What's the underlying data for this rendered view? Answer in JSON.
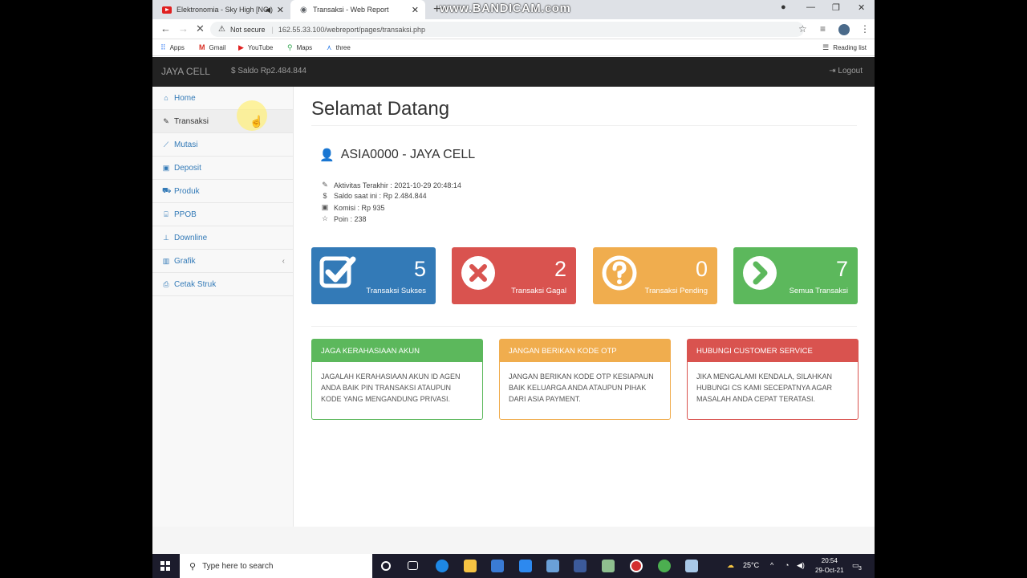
{
  "browser": {
    "tabs": [
      {
        "title": "Elektronomia - Sky High [NC",
        "icon": "youtube-icon"
      },
      {
        "title": "Transaksi - Web Report",
        "icon": "page-icon"
      }
    ],
    "watermark": "www.BANDICAM.com",
    "security": "Not secure",
    "url": "162.55.33.100/webreport/pages/transaksi.php",
    "bookmarks": [
      "Apps",
      "Gmail",
      "YouTube",
      "Maps",
      "three"
    ],
    "reading_list": "Reading list"
  },
  "app": {
    "brand": "JAYA CELL",
    "saldo": "Saldo Rp2.484.844",
    "logout": "Logout"
  },
  "sidebar": {
    "items": [
      {
        "label": "Home",
        "icon": "home-icon"
      },
      {
        "label": "Transaksi",
        "icon": "edit-icon"
      },
      {
        "label": "Mutasi",
        "icon": "line-chart-icon"
      },
      {
        "label": "Deposit",
        "icon": "money-icon"
      },
      {
        "label": "Produk",
        "icon": "truck-icon"
      },
      {
        "label": "PPOB",
        "icon": "bank-icon"
      },
      {
        "label": "Downline",
        "icon": "sitemap-icon"
      },
      {
        "label": "Grafik",
        "icon": "bar-chart-icon"
      },
      {
        "label": "Cetak Struk",
        "icon": "print-icon"
      }
    ]
  },
  "main": {
    "title": "Selamat Datang",
    "user": "ASIA0000 - JAYA CELL",
    "info": [
      "Aktivitas Terakhir : 2021-10-29 20:48:14",
      "Saldo saat ini : Rp 2.484.844",
      "Komisi : Rp 935",
      "Poin : 238"
    ],
    "panels": [
      {
        "count": "5",
        "label": "Transaksi Sukses",
        "color": "#337ab7",
        "icon": "check-square-icon"
      },
      {
        "count": "2",
        "label": "Transaksi Gagal",
        "color": "#d9534f",
        "icon": "times-circle-icon"
      },
      {
        "count": "0",
        "label": "Transaksi Pending",
        "color": "#f0ad4e",
        "icon": "question-circle-icon"
      },
      {
        "count": "7",
        "label": "Semua Transaksi",
        "color": "#5cb85c",
        "icon": "chevron-circle-right-icon"
      }
    ],
    "notices": [
      {
        "title": "JAGA KERAHASIAAN AKUN",
        "body": "JAGALAH KERAHASIAAN AKUN ID AGEN ANDA BAIK PIN TRANSAKSI ATAUPUN KODE YANG MENGANDUNG PRIVASI.",
        "color": "#5cb85c"
      },
      {
        "title": "JANGAN BERIKAN KODE OTP",
        "body": "JANGAN BERIKAN KODE OTP KESIAPAUN BAIK KELUARGA ANDA ATAUPUN PIHAK DARI ASIA PAYMENT.",
        "color": "#f0ad4e"
      },
      {
        "title": "HUBUNGI CUSTOMER SERVICE",
        "body": "JIKA MENGALAMI KENDALA, SILAHKAN HUBUNGI CS KAMI SECEPATNYA AGAR MASALAH ANDA CEPAT TERATASI.",
        "color": "#d9534f"
      }
    ]
  },
  "taskbar": {
    "search_placeholder": "Type here to search",
    "temperature": "25°C",
    "time": "20:54",
    "date": "29-Oct-21",
    "notifications": "3"
  }
}
